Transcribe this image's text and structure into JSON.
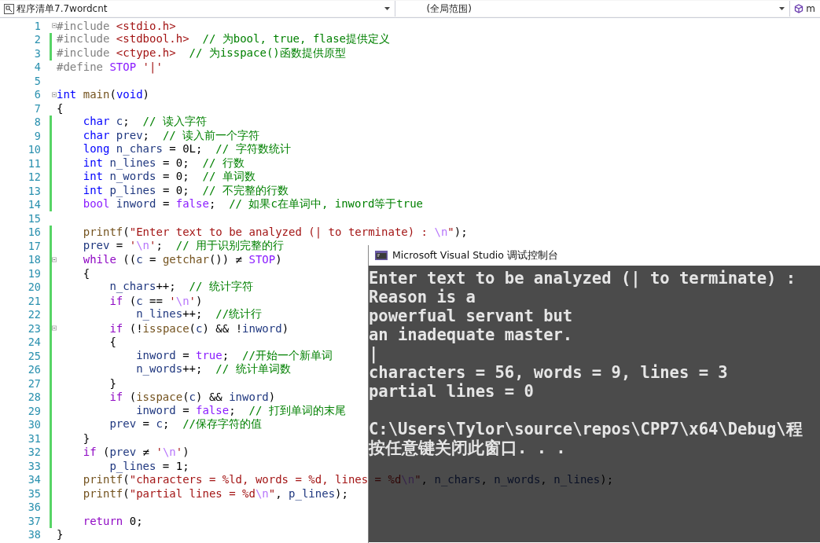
{
  "navigation_bar": {
    "file_dropdown": "程序清单7.7wordcnt",
    "scope_dropdown": "(全局范围)",
    "member_dropdown": "m"
  },
  "editor": {
    "lines": [
      {
        "number": "1",
        "changed": false,
        "fold": true,
        "tokens": [
          {
            "kind": "pp",
            "text": "#include"
          },
          {
            "kind": "inc",
            "text": " <stdio.h>"
          }
        ]
      },
      {
        "number": "2",
        "changed": true,
        "fold": false,
        "tokens": [
          {
            "kind": "pp",
            "text": "#include"
          },
          {
            "kind": "inc",
            "text": " <stdbool.h>"
          },
          {
            "kind": "cmt",
            "text": "  // 为bool, true, flase提供定义"
          }
        ]
      },
      {
        "number": "3",
        "changed": true,
        "fold": false,
        "tokens": [
          {
            "kind": "pp",
            "text": "#include"
          },
          {
            "kind": "inc",
            "text": " <ctype.h>"
          },
          {
            "kind": "cmt",
            "text": "  // 为isspace()函数提供原型"
          }
        ]
      },
      {
        "number": "4",
        "changed": false,
        "fold": false,
        "tokens": [
          {
            "kind": "pp",
            "text": "#define"
          },
          {
            "kind": "mac",
            "text": " STOP"
          },
          {
            "kind": "str",
            "text": " '|'"
          }
        ]
      },
      {
        "number": "5",
        "changed": false,
        "fold": false
      },
      {
        "number": "6",
        "changed": false,
        "fold": true,
        "tokens": [
          {
            "kind": "kw",
            "text": "int"
          },
          {
            "kind": "fn",
            "text": " main"
          },
          {
            "kind": "plain",
            "text": "("
          },
          {
            "kind": "kw",
            "text": "void"
          },
          {
            "kind": "plain",
            "text": ")"
          }
        ]
      },
      {
        "number": "7",
        "changed": false,
        "fold": false,
        "tokens": [
          {
            "kind": "plain",
            "text": "{"
          }
        ]
      },
      {
        "number": "8",
        "changed": true,
        "fold": false,
        "tokens": [
          {
            "kind": "kw",
            "text": "    char"
          },
          {
            "kind": "var",
            "text": " c"
          },
          {
            "kind": "plain",
            "text": ";"
          },
          {
            "kind": "cmt",
            "text": "  // 读入字符"
          }
        ]
      },
      {
        "number": "9",
        "changed": true,
        "fold": false,
        "tokens": [
          {
            "kind": "kw",
            "text": "    char"
          },
          {
            "kind": "var",
            "text": " prev"
          },
          {
            "kind": "plain",
            "text": ";"
          },
          {
            "kind": "cmt",
            "text": "  // 读入前一个字符"
          }
        ]
      },
      {
        "number": "10",
        "changed": true,
        "fold": false,
        "tokens": [
          {
            "kind": "kw",
            "text": "    long"
          },
          {
            "kind": "var",
            "text": " n_chars"
          },
          {
            "kind": "plain",
            "text": " = 0L;"
          },
          {
            "kind": "cmt",
            "text": "  // 字符数统计"
          }
        ]
      },
      {
        "number": "11",
        "changed": true,
        "fold": false,
        "tokens": [
          {
            "kind": "kw",
            "text": "    int"
          },
          {
            "kind": "var",
            "text": " n_lines"
          },
          {
            "kind": "plain",
            "text": " = 0;"
          },
          {
            "kind": "cmt",
            "text": "  // 行数"
          }
        ]
      },
      {
        "number": "12",
        "changed": true,
        "fold": false,
        "tokens": [
          {
            "kind": "kw",
            "text": "    int"
          },
          {
            "kind": "var",
            "text": " n_words"
          },
          {
            "kind": "plain",
            "text": " = 0;"
          },
          {
            "kind": "cmt",
            "text": "  // 单词数"
          }
        ]
      },
      {
        "number": "13",
        "changed": true,
        "fold": false,
        "tokens": [
          {
            "kind": "kw",
            "text": "    int"
          },
          {
            "kind": "var",
            "text": " p_lines"
          },
          {
            "kind": "plain",
            "text": " = 0;"
          },
          {
            "kind": "cmt",
            "text": "  // 不完整的行数"
          }
        ]
      },
      {
        "number": "14",
        "changed": true,
        "fold": false,
        "tokens": [
          {
            "kind": "mac",
            "text": "    bool"
          },
          {
            "kind": "var",
            "text": " inword"
          },
          {
            "kind": "plain",
            "text": " ="
          },
          {
            "kind": "mac",
            "text": " false"
          },
          {
            "kind": "plain",
            "text": ";"
          },
          {
            "kind": "cmt",
            "text": "  // 如果c在单词中, inword等于true"
          }
        ]
      },
      {
        "number": "15",
        "changed": false,
        "fold": false
      },
      {
        "number": "16",
        "changed": true,
        "fold": false,
        "tokens": [
          {
            "kind": "fn",
            "text": "    printf"
          },
          {
            "kind": "plain",
            "text": "("
          },
          {
            "kind": "str",
            "text": "\"Enter text to be analyzed (| to terminate) : "
          },
          {
            "kind": "esc",
            "text": "\\n"
          },
          {
            "kind": "str",
            "text": "\""
          },
          {
            "kind": "plain",
            "text": ");"
          }
        ]
      },
      {
        "number": "17",
        "changed": true,
        "fold": false,
        "tokens": [
          {
            "kind": "var",
            "text": "    prev"
          },
          {
            "kind": "plain",
            "text": " ="
          },
          {
            "kind": "str",
            "text": " '"
          },
          {
            "kind": "esc",
            "text": "\\n"
          },
          {
            "kind": "str",
            "text": "'"
          },
          {
            "kind": "plain",
            "text": ";"
          },
          {
            "kind": "cmt",
            "text": "  // 用于识别完整的行"
          }
        ]
      },
      {
        "number": "18",
        "changed": true,
        "fold": true,
        "tokens": [
          {
            "kind": "ctl",
            "text": "    while"
          },
          {
            "kind": "plain",
            "text": " (("
          },
          {
            "kind": "var",
            "text": "c"
          },
          {
            "kind": "plain",
            "text": " ="
          },
          {
            "kind": "fn",
            "text": " getchar"
          },
          {
            "kind": "plain",
            "text": "()) ≠"
          },
          {
            "kind": "mac",
            "text": " STOP"
          },
          {
            "kind": "plain",
            "text": ")"
          }
        ]
      },
      {
        "number": "19",
        "changed": true,
        "fold": false,
        "tokens": [
          {
            "kind": "plain",
            "text": "    {"
          }
        ]
      },
      {
        "number": "20",
        "changed": true,
        "fold": false,
        "tokens": [
          {
            "kind": "var",
            "text": "        n_chars"
          },
          {
            "kind": "plain",
            "text": "++;"
          },
          {
            "kind": "cmt",
            "text": "  // 统计字符"
          }
        ]
      },
      {
        "number": "21",
        "changed": true,
        "fold": false,
        "tokens": [
          {
            "kind": "ctl",
            "text": "        if"
          },
          {
            "kind": "plain",
            "text": " ("
          },
          {
            "kind": "var",
            "text": "c"
          },
          {
            "kind": "plain",
            "text": " =="
          },
          {
            "kind": "str",
            "text": " '"
          },
          {
            "kind": "esc",
            "text": "\\n"
          },
          {
            "kind": "str",
            "text": "'"
          },
          {
            "kind": "plain",
            "text": ")"
          }
        ]
      },
      {
        "number": "22",
        "changed": true,
        "fold": false,
        "tokens": [
          {
            "kind": "var",
            "text": "            n_lines"
          },
          {
            "kind": "plain",
            "text": "++;"
          },
          {
            "kind": "cmt",
            "text": "  //统计行"
          }
        ]
      },
      {
        "number": "23",
        "changed": true,
        "fold": true,
        "tokens": [
          {
            "kind": "ctl",
            "text": "        if"
          },
          {
            "kind": "plain",
            "text": " (!"
          },
          {
            "kind": "fn",
            "text": "isspace"
          },
          {
            "kind": "plain",
            "text": "("
          },
          {
            "kind": "var",
            "text": "c"
          },
          {
            "kind": "plain",
            "text": ") && !"
          },
          {
            "kind": "var",
            "text": "inword"
          },
          {
            "kind": "plain",
            "text": ")"
          }
        ]
      },
      {
        "number": "24",
        "changed": true,
        "fold": false,
        "tokens": [
          {
            "kind": "plain",
            "text": "        {"
          }
        ]
      },
      {
        "number": "25",
        "changed": true,
        "fold": false,
        "tokens": [
          {
            "kind": "var",
            "text": "            inword"
          },
          {
            "kind": "plain",
            "text": " ="
          },
          {
            "kind": "mac",
            "text": " true"
          },
          {
            "kind": "plain",
            "text": ";"
          },
          {
            "kind": "cmt",
            "text": "  //开始一个新单词"
          }
        ]
      },
      {
        "number": "26",
        "changed": true,
        "fold": false,
        "tokens": [
          {
            "kind": "var",
            "text": "            n_words"
          },
          {
            "kind": "plain",
            "text": "++;"
          },
          {
            "kind": "cmt",
            "text": "  // 统计单词数"
          }
        ]
      },
      {
        "number": "27",
        "changed": true,
        "fold": false,
        "tokens": [
          {
            "kind": "plain",
            "text": "        }"
          }
        ]
      },
      {
        "number": "28",
        "changed": true,
        "fold": false,
        "tokens": [
          {
            "kind": "ctl",
            "text": "        if"
          },
          {
            "kind": "plain",
            "text": " ("
          },
          {
            "kind": "fn",
            "text": "isspace"
          },
          {
            "kind": "plain",
            "text": "("
          },
          {
            "kind": "var",
            "text": "c"
          },
          {
            "kind": "plain",
            "text": ") &&"
          },
          {
            "kind": "var",
            "text": " inword"
          },
          {
            "kind": "plain",
            "text": ")"
          }
        ]
      },
      {
        "number": "29",
        "changed": true,
        "fold": false,
        "tokens": [
          {
            "kind": "var",
            "text": "            inword"
          },
          {
            "kind": "plain",
            "text": " ="
          },
          {
            "kind": "mac",
            "text": " false"
          },
          {
            "kind": "plain",
            "text": ";"
          },
          {
            "kind": "cmt",
            "text": "  // 打到单词的末尾"
          }
        ]
      },
      {
        "number": "30",
        "changed": true,
        "fold": false,
        "tokens": [
          {
            "kind": "var",
            "text": "        prev"
          },
          {
            "kind": "plain",
            "text": " ="
          },
          {
            "kind": "var",
            "text": " c"
          },
          {
            "kind": "plain",
            "text": ";"
          },
          {
            "kind": "cmt",
            "text": "  //保存字符的值"
          }
        ]
      },
      {
        "number": "31",
        "changed": true,
        "fold": false,
        "tokens": [
          {
            "kind": "plain",
            "text": "    }"
          }
        ]
      },
      {
        "number": "32",
        "changed": true,
        "fold": false,
        "tokens": [
          {
            "kind": "ctl",
            "text": "    if"
          },
          {
            "kind": "plain",
            "text": " ("
          },
          {
            "kind": "var",
            "text": "prev"
          },
          {
            "kind": "plain",
            "text": " ≠"
          },
          {
            "kind": "str",
            "text": " '"
          },
          {
            "kind": "esc",
            "text": "\\n"
          },
          {
            "kind": "str",
            "text": "'"
          },
          {
            "kind": "plain",
            "text": ")"
          }
        ]
      },
      {
        "number": "33",
        "changed": true,
        "fold": false,
        "tokens": [
          {
            "kind": "var",
            "text": "        p_lines"
          },
          {
            "kind": "plain",
            "text": " = 1;"
          }
        ]
      },
      {
        "number": "34",
        "changed": true,
        "fold": false,
        "tokens": [
          {
            "kind": "fn",
            "text": "    printf"
          },
          {
            "kind": "plain",
            "text": "("
          },
          {
            "kind": "str",
            "text": "\"characters = %ld, words = %d, lines = %d"
          },
          {
            "kind": "esc",
            "text": "\\n"
          },
          {
            "kind": "str",
            "text": "\""
          },
          {
            "kind": "plain",
            "text": ","
          },
          {
            "kind": "var",
            "text": " n_chars"
          },
          {
            "kind": "plain",
            "text": ","
          },
          {
            "kind": "var",
            "text": " n_words"
          },
          {
            "kind": "plain",
            "text": ","
          },
          {
            "kind": "var",
            "text": " n_lines"
          },
          {
            "kind": "plain",
            "text": ");"
          }
        ]
      },
      {
        "number": "35",
        "changed": true,
        "fold": false,
        "tokens": [
          {
            "kind": "fn",
            "text": "    printf"
          },
          {
            "kind": "plain",
            "text": "("
          },
          {
            "kind": "str",
            "text": "\"partial lines = %d"
          },
          {
            "kind": "esc",
            "text": "\\n"
          },
          {
            "kind": "str",
            "text": "\""
          },
          {
            "kind": "plain",
            "text": ","
          },
          {
            "kind": "var",
            "text": " p_lines"
          },
          {
            "kind": "plain",
            "text": ");"
          }
        ]
      },
      {
        "number": "36",
        "changed": true,
        "fold": false
      },
      {
        "number": "37",
        "changed": true,
        "fold": false,
        "tokens": [
          {
            "kind": "ctl",
            "text": "    return"
          },
          {
            "kind": "plain",
            "text": " 0;"
          }
        ]
      },
      {
        "number": "38",
        "changed": false,
        "fold": false,
        "tokens": [
          {
            "kind": "plain",
            "text": "}"
          }
        ]
      }
    ]
  },
  "console": {
    "title": "Microsoft Visual Studio 调试控制台",
    "output": [
      "Enter text to be analyzed (| to terminate) :",
      "Reason is a",
      "powerfual servant but",
      "an inadequate master.",
      "|",
      "characters = 56, words = 9, lines = 3",
      "partial lines = 0"
    ],
    "exit_message": [
      "C:\\Users\\Tylor\\source\\repos\\CPP7\\x64\\Debug\\程",
      "按任意键关闭此窗口. . ."
    ]
  }
}
